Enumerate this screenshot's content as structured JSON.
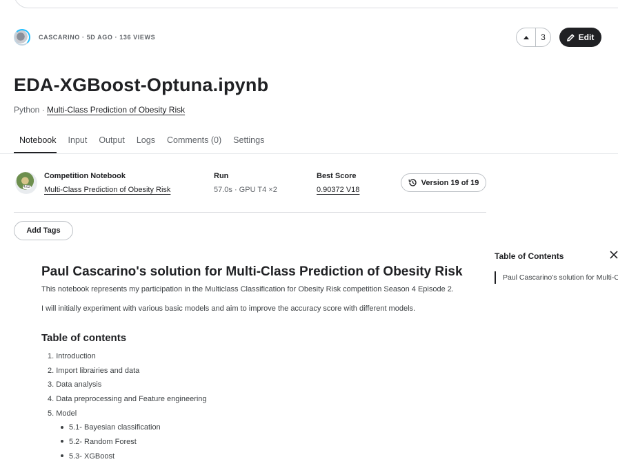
{
  "header": {
    "meta": "CASCARINO · 5D AGO · 136 VIEWS",
    "vote_count": "3",
    "edit_label": "Edit"
  },
  "notebook": {
    "title": "EDA-XGBoost-Optuna.ipynb",
    "language": "Python",
    "separator": "·",
    "competition_link": "Multi-Class Prediction of Obesity Risk"
  },
  "tabs": [
    {
      "label": "Notebook",
      "active": true
    },
    {
      "label": "Input"
    },
    {
      "label": "Output"
    },
    {
      "label": "Logs"
    },
    {
      "label": "Comments (0)"
    },
    {
      "label": "Settings"
    }
  ],
  "info": {
    "competition_label": "Competition Notebook",
    "competition_value": "Multi-Class Prediction of Obesity Risk",
    "avatar_tier": "4.02",
    "run_label": "Run",
    "run_value": "57.0s · GPU T4 ×2",
    "score_label": "Best Score",
    "score_value": "0.90372 V18",
    "version_label": "Version 19 of 19"
  },
  "add_tags_label": "Add Tags",
  "content": {
    "heading": "Paul Cascarino's solution for Multi-Class Prediction of Obesity Risk",
    "paragraph1": "This notebook represents my participation in the Multiclass Classification for Obesity Risk competition Season 4 Episode 2.",
    "paragraph2": "I will initially experiment with various basic models and aim to improve the accuracy score with different models.",
    "toc_heading": "Table of contents",
    "toc_items": [
      "1. Introduction",
      "2. Import librairies and data",
      "3. Data analysis",
      "4. Data preprocessing and Feature engineering",
      "5. Model"
    ],
    "toc_subitems": [
      "5.1- Bayesian classification",
      "5.2- Random Forest",
      "5.3- XGBoost"
    ]
  },
  "sidebar_toc": {
    "title": "Table of Contents",
    "close_icon": "close-icon",
    "item": "Paul Cascarino's solution for Multi-Class Prediction of Obesity Risk"
  },
  "colors": {
    "text": "#202124",
    "muted": "#5f6368",
    "accent": "#20beff",
    "edit_button": "#202124"
  }
}
